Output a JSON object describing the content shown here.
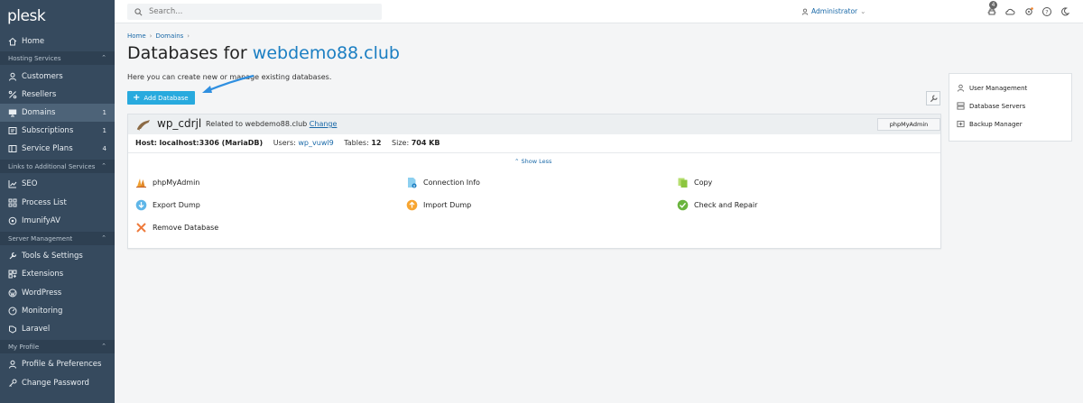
{
  "app": {
    "logo": "plesk"
  },
  "sidebar": {
    "home": "Home",
    "sections": {
      "hosting": "Hosting Services",
      "links": "Links to Additional Services",
      "server": "Server Management",
      "profile": "My Profile"
    },
    "items": {
      "customers": "Customers",
      "resellers": "Resellers",
      "domains": "Domains",
      "domains_count": "1",
      "subscriptions": "Subscriptions",
      "subscriptions_count": "1",
      "service_plans": "Service Plans",
      "service_plans_count": "4",
      "seo": "SEO",
      "process_list": "Process List",
      "imunify": "ImunifyAV",
      "tools": "Tools & Settings",
      "extensions": "Extensions",
      "wordpress": "WordPress",
      "monitoring": "Monitoring",
      "laravel": "Laravel",
      "profile_prefs": "Profile & Preferences",
      "change_password": "Change Password"
    }
  },
  "topbar": {
    "search_placeholder": "Search...",
    "user": "Administrator",
    "notifications_count": "4"
  },
  "breadcrumb": {
    "home": "Home",
    "domains": "Domains"
  },
  "page": {
    "title_prefix": "Databases for",
    "title_domain": "webdemo88.club",
    "intro": "Here you can create new or manage existing databases.",
    "add_button": "Add Database"
  },
  "database": {
    "name": "wp_cdrjl",
    "related_prefix": "Related to webdemo88.club",
    "change_link": "Change",
    "phpmyadmin_button": "phpMyAdmin",
    "host_label": "Host:",
    "host_value": "localhost:3306 (MariaDB)",
    "users_label": "Users:",
    "users_value": "wp_vuwl9",
    "tables_label": "Tables:",
    "tables_value": "12",
    "size_label": "Size:",
    "size_value": "704 KB",
    "show_less": "Show Less",
    "actions": {
      "phpmyadmin": "phpMyAdmin",
      "connection_info": "Connection Info",
      "copy": "Copy",
      "export_dump": "Export Dump",
      "import_dump": "Import Dump",
      "check_repair": "Check and Repair",
      "remove": "Remove Database"
    }
  },
  "right_panel": {
    "user_management": "User Management",
    "database_servers": "Database Servers",
    "backup_manager": "Backup Manager"
  },
  "colors": {
    "sidebar": "#364a5e",
    "accent": "#28aade",
    "link": "#1a69a8"
  }
}
